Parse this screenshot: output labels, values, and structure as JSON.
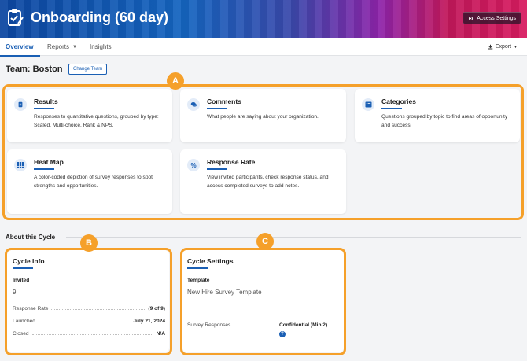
{
  "header": {
    "title": "Onboarding (60 day)",
    "access_settings": "Access Settings",
    "logo_icon": "clipboard-check-icon",
    "gradient": [
      "#0d47a1",
      "#8e24aa",
      "#d81b60"
    ]
  },
  "nav": {
    "tabs": [
      {
        "label": "Overview",
        "active": true
      },
      {
        "label": "Reports",
        "has_dropdown": true
      },
      {
        "label": "Insights"
      }
    ],
    "export_label": "Export"
  },
  "team": {
    "title": "Team: Boston",
    "change_button": "Change Team"
  },
  "annotations": {
    "a": "A",
    "b": "B",
    "c": "C",
    "color": "#f5a02a"
  },
  "cards": [
    {
      "title": "Results",
      "icon": "document-icon",
      "description": "Responses to quantitative questions, grouped by type: Scaled, Multi-choice, Rank & NPS."
    },
    {
      "title": "Comments",
      "icon": "chat-bubbles-icon",
      "description": "What people are saying about your organization."
    },
    {
      "title": "Categories",
      "icon": "list-icon",
      "description": "Questions grouped by topic to find areas of opportunity and success."
    },
    {
      "title": "Heat Map",
      "icon": "grid-icon",
      "description": "A color-coded depiction of survey responses to spot strengths and opportunities."
    },
    {
      "title": "Response Rate",
      "icon": "percent-icon",
      "description": "View invited participants, check response status, and access completed surveys to add notes."
    }
  ],
  "about": {
    "title": "About this Cycle",
    "cycle_info": {
      "title": "Cycle Info",
      "invited_label": "Invited",
      "invited_value": "9",
      "rows": [
        {
          "label": "Response Rate",
          "value": "(9 of 9)"
        },
        {
          "label": "Launched",
          "value": "July 21, 2024"
        },
        {
          "label": "Closed",
          "value": "N/A"
        }
      ]
    },
    "cycle_settings": {
      "title": "Cycle Settings",
      "template_label": "Template",
      "template_value": "New Hire Survey Template",
      "survey_responses_label": "Survey Responses",
      "survey_responses_value": "Confidential (Min 2)",
      "help_icon": "question-circle-icon"
    }
  },
  "accent": "#1a5fb4"
}
